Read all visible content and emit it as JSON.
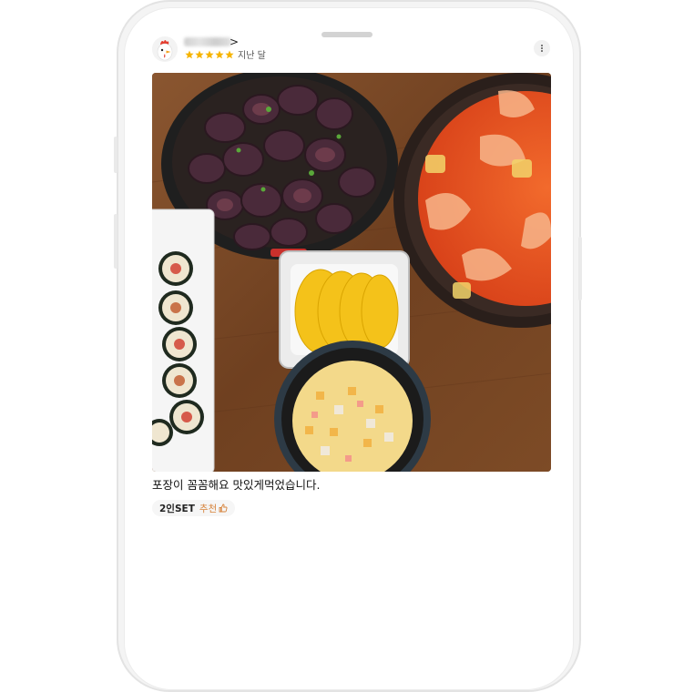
{
  "review": {
    "author_chevron": ">",
    "rating": 5,
    "date": "지난 달",
    "text": "포장이 꼼꼼해요 맛있게먹었습니다.",
    "menu_item": "2인SET",
    "recommend_label": "추천"
  },
  "colors": {
    "star": "#f6b400",
    "recommend": "#d6823a"
  },
  "icons": [
    "chicken-avatar-icon",
    "star-icon",
    "more-options-icon",
    "thumbs-up-icon"
  ]
}
